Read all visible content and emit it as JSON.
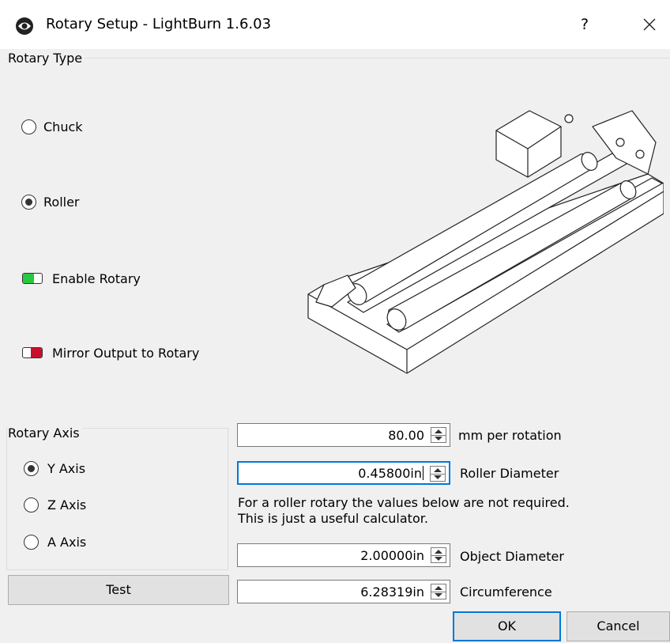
{
  "window": {
    "title": "Rotary Setup - LightBurn 1.6.03",
    "help_label": "?",
    "close_icon": "close-icon",
    "app_icon": "lightburn-icon"
  },
  "rotary_type": {
    "group_title": "Rotary Type",
    "options": [
      {
        "label": "Chuck",
        "checked": false
      },
      {
        "label": "Roller",
        "checked": true
      }
    ],
    "toggles": [
      {
        "label": "Enable Rotary",
        "on": true,
        "color": "#27c93f"
      },
      {
        "label": "Mirror Output to Rotary",
        "on": false,
        "color": "#c8102e"
      }
    ],
    "image": "roller-rotary-illustration"
  },
  "rotary_axis": {
    "group_title": "Rotary Axis",
    "options": [
      {
        "label": "Y Axis",
        "checked": true
      },
      {
        "label": "Z Axis",
        "checked": false
      },
      {
        "label": "A Axis",
        "checked": false
      }
    ]
  },
  "fields": {
    "mm_per_rotation": {
      "value": "80.00",
      "label": "mm per rotation"
    },
    "roller_diameter": {
      "value": "0.45800in",
      "label": "Roller Diameter"
    },
    "object_diameter": {
      "value": "2.00000in",
      "label": "Object Diameter"
    },
    "circumference": {
      "value": "6.28319in",
      "label": "Circumference"
    }
  },
  "info": {
    "line1": "For a roller rotary the values below are not required.",
    "line2": "This is just a useful calculator."
  },
  "buttons": {
    "test": "Test",
    "ok": "OK",
    "cancel": "Cancel"
  },
  "colors": {
    "focus_accent": "#0078d7",
    "dialog_bg": "#f0f0f0"
  }
}
